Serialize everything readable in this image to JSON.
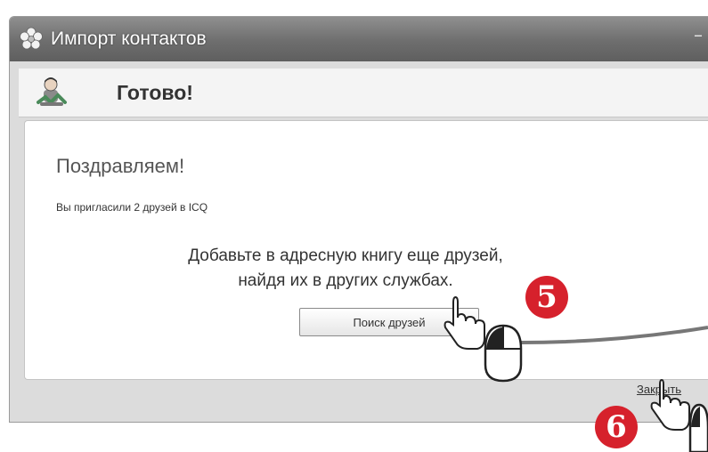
{
  "window": {
    "title": "Импорт контактов",
    "minimize": "–",
    "icon": "flower-icon"
  },
  "header": {
    "title": "Готово!",
    "icon": "user-icon"
  },
  "content": {
    "congrats": "Поздравляем!",
    "invited": "Вы пригласили 2 друзей в ICQ",
    "add_more_line1": "Добавьте в адресную книгу еще друзей,",
    "add_more_line2": "найдя их в других службах.",
    "search_button": "Поиск друзей"
  },
  "footer": {
    "close_link": "Закрыть"
  },
  "annotations": {
    "step_5": "5",
    "step_6": "6",
    "badge_color": "#d6212c",
    "pointer_icon": "hand-pointer-icon",
    "mouse_icon": "mouse-icon"
  }
}
